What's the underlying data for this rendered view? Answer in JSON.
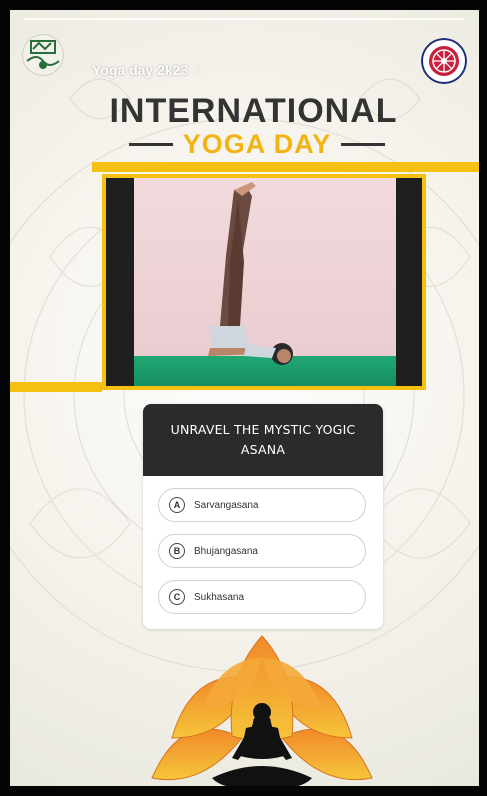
{
  "story": {
    "title": "Yoga day 2k23",
    "time": "3 d"
  },
  "banner": {
    "line1": "INTERNATIONAL",
    "line2": "YOGA DAY"
  },
  "quiz": {
    "question": "UNRAVEL THE MYSTIC YOGIC ASANA",
    "options": [
      {
        "letter": "A",
        "label": "Sarvangasana"
      },
      {
        "letter": "B",
        "label": "Bhujangasana"
      },
      {
        "letter": "C",
        "label": "Sukhasana"
      }
    ]
  },
  "icons": [
    "user-avatar-icon",
    "emblem-icon",
    "lotus-meditation-icon"
  ],
  "colors": {
    "accent_yellow": "#f4c012",
    "title_yellow": "#f2b414",
    "dark_text": "#333333",
    "quiz_header": "#2b2b2b",
    "mat_green": "#1fa874",
    "wall_pink": "#f3dadd"
  }
}
